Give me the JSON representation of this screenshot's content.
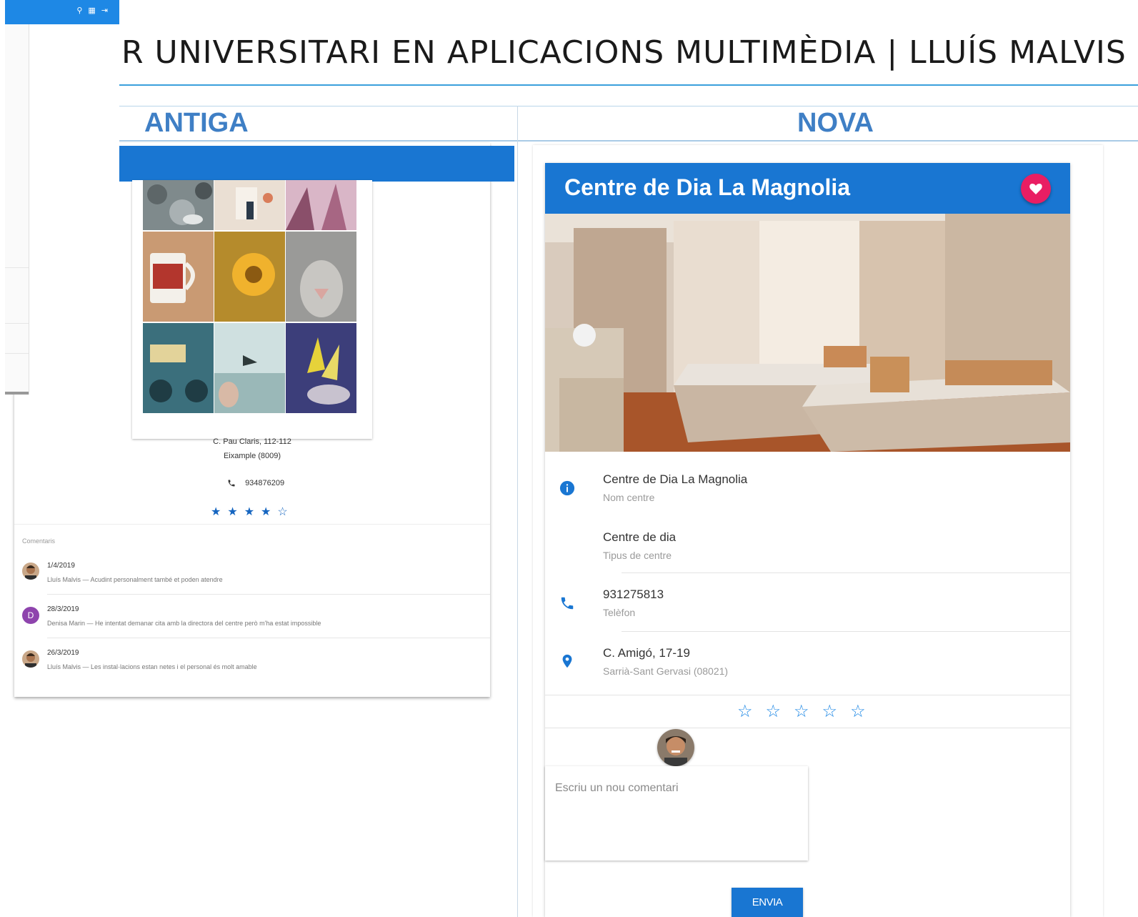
{
  "slide": {
    "title": "R UNIVERSITARI EN APLICACIONS MULTIMÈDIA | LLUÍS MALVIS"
  },
  "comparison": {
    "old_heading": "ANTIGA",
    "new_heading": "NOVA"
  },
  "old_app": {
    "address_line1": "C. Pau Claris, 112-112",
    "address_line2": "Eixample (8009)",
    "phone": "934876209",
    "rating_value": 4,
    "rating_max": 5,
    "comments_label": "Comentaris",
    "comments": [
      {
        "avatar": "photo",
        "date": "1/4/2019",
        "text": "Lluís Malvis — Acudint personalment també et poden atendre"
      },
      {
        "avatar": "D",
        "date": "28/3/2019",
        "text": "Denisa Marin — He intentat demanar cita amb la directora del centre però m'ha estat impossible"
      },
      {
        "avatar": "photo",
        "date": "26/3/2019",
        "text": "Lluís Malvis — Les instal·lacions estan netes i el personal és molt amable"
      }
    ],
    "overlay_icons": [
      "search-icon",
      "grid-icon",
      "logout-icon"
    ],
    "brand_color": "#1976d2"
  },
  "new_app": {
    "header_title": "Centre de Dia La Magnolia",
    "favorite_color": "#e91e63",
    "info": {
      "name_value": "Centre de Dia La Magnolia",
      "name_label": "Nom centre",
      "type_value": "Centre de dia",
      "type_label": "Tipus de centre",
      "phone_value": "931275813",
      "phone_label": "Telèfon",
      "address_value": "C. Amigó, 17-19",
      "address_label": "Sarrià-Sant Gervasi (08021)"
    },
    "rating_value": 0,
    "rating_max": 5,
    "comment_placeholder": "Escriu un nou comentari",
    "send_label": "ENVIA",
    "accent_color": "#1e88e5"
  }
}
